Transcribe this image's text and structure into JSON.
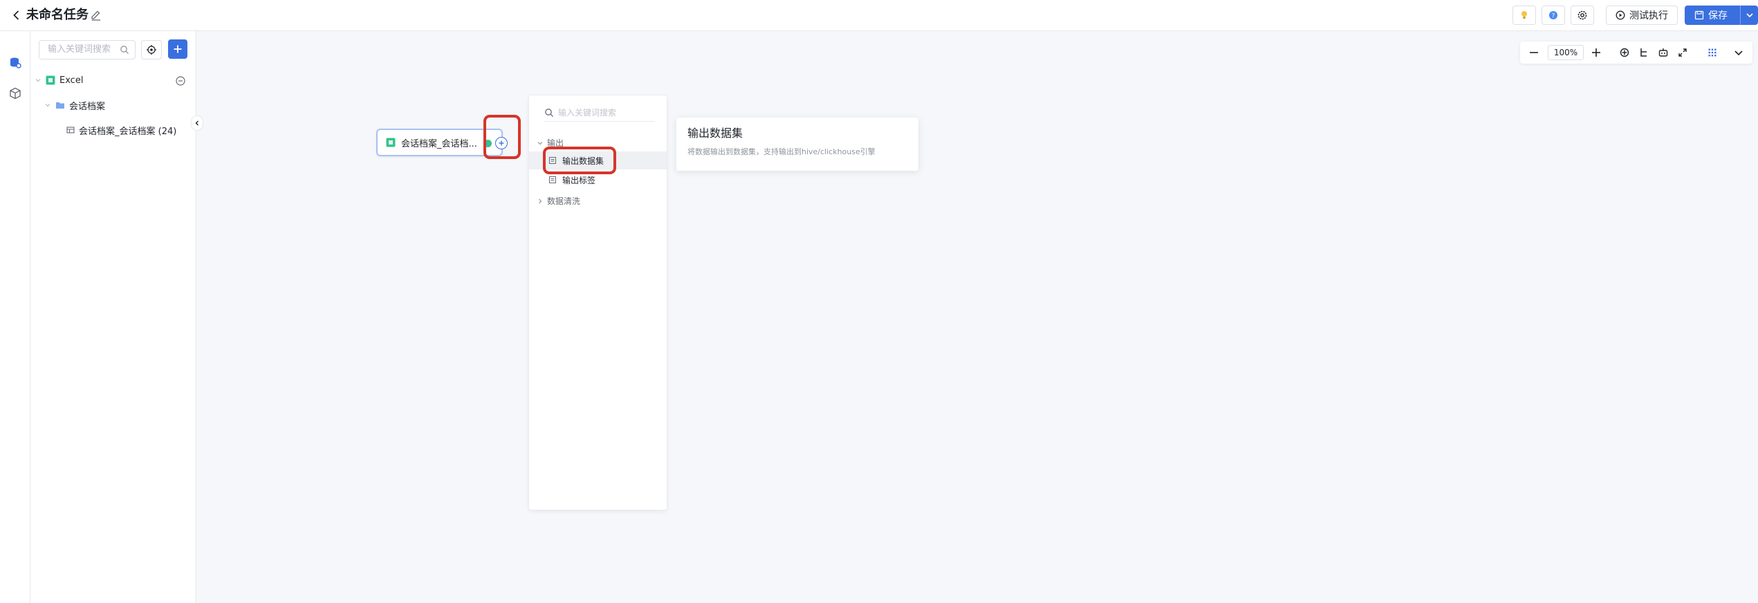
{
  "header": {
    "title": "未命名任务",
    "test_label": "测试执行",
    "save_label": "保存"
  },
  "sidebar": {
    "search_placeholder": "输入关键词搜索",
    "tree": [
      {
        "label": "Excel",
        "level": 0
      },
      {
        "label": "会话档案",
        "level": 1
      },
      {
        "label": "会话档案_会话档案 (24)",
        "level": 2
      }
    ]
  },
  "toolbar": {
    "zoom": "100%"
  },
  "node": {
    "label": "会话档案_会话档..."
  },
  "menu": {
    "search_placeholder": "输入关键词搜索",
    "group_output": "输出",
    "items": [
      {
        "label": "输出数据集",
        "active": true
      },
      {
        "label": "输出标签",
        "active": false
      }
    ],
    "group_cleaning": "数据清洗"
  },
  "tooltip": {
    "title": "输出数据集",
    "description": "将数据输出到数据集，支持输出到hive/clickhouse引擎"
  },
  "colors": {
    "primary": "#3a6fe0",
    "highlight": "#d6342b",
    "success": "#34c38f"
  }
}
